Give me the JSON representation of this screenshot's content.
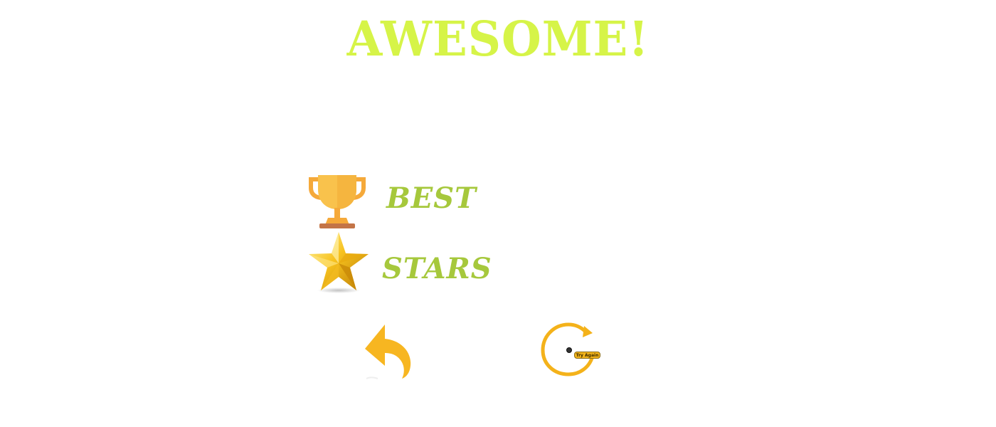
{
  "result": {
    "title": "AWESOME!"
  },
  "stats": {
    "best_label": "BEST",
    "stars_label": "STARS",
    "best_icon": "trophy-icon",
    "stars_icon": "star-icon"
  },
  "buttons": {
    "back_icon": "undo-arrow-icon",
    "retry_icon": "retry-icon",
    "retry_label": "Try Again"
  },
  "colors": {
    "title": "#d6f448",
    "label": "#a6c83c",
    "accent": "#f3b41c",
    "trophy": "#f9c24c"
  }
}
